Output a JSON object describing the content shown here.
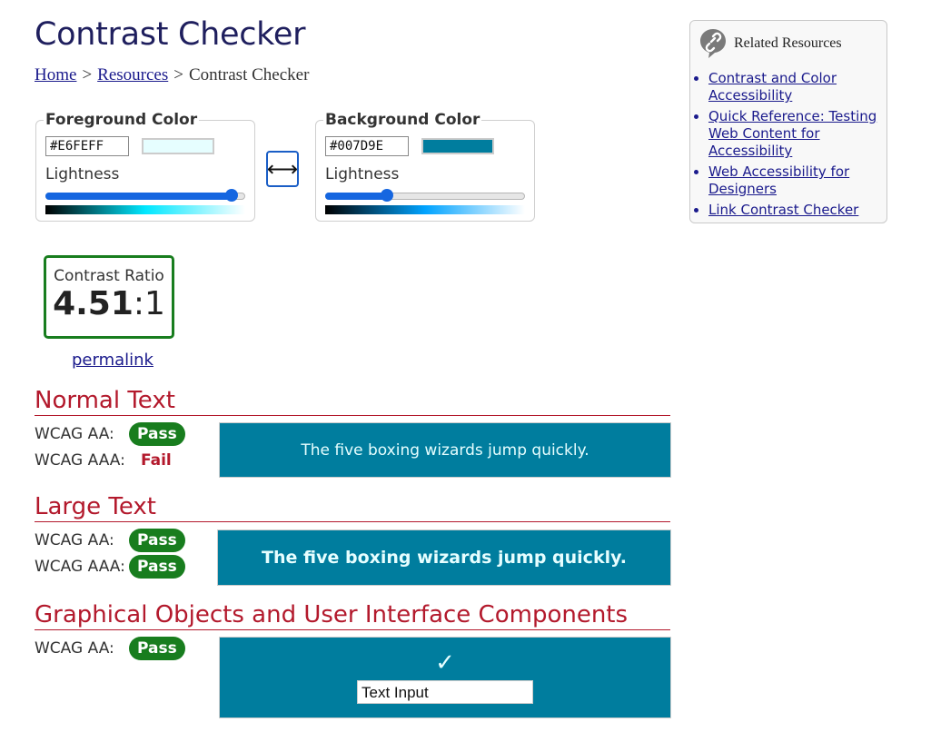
{
  "page": {
    "title": "Contrast Checker",
    "breadcrumb": {
      "home": "Home",
      "sep": ">",
      "resources": "Resources",
      "current": "Contrast Checker"
    }
  },
  "foreground": {
    "legend": "Foreground Color",
    "hex": "#E6FEFF",
    "swatch_color": "#E6FEFF",
    "lightness_label": "Lightness",
    "lightness_percent": 93,
    "gradient_colors": [
      "#000000",
      "#00e7ff",
      "#ffffff"
    ]
  },
  "background": {
    "legend": "Background Color",
    "hex": "#007D9E",
    "swatch_color": "#007D9E",
    "lightness_label": "Lightness",
    "lightness_percent": 31,
    "gradient_colors": [
      "#000000",
      "#00a3ff",
      "#ffffff"
    ]
  },
  "swap": {
    "icon": "swap-arrows-icon",
    "glyph": "⟷"
  },
  "ratio": {
    "label": "Contrast Ratio",
    "value": "4.51",
    "suffix": ":1",
    "border_color": "#187d1e"
  },
  "permalink": "permalink",
  "sections": {
    "normal": {
      "title": "Normal Text",
      "aa_label": "WCAG AA:",
      "aa_result": "Pass",
      "aaa_label": "WCAG AAA:",
      "aaa_result": "Fail",
      "sample": "The five boxing wizards jump quickly."
    },
    "large": {
      "title": "Large Text",
      "aa_label": "WCAG AA:",
      "aa_result": "Pass",
      "aaa_label": "WCAG AAA:",
      "aaa_result": "Pass",
      "sample": "The five boxing wizards jump quickly."
    },
    "ui": {
      "title": "Graphical Objects and User Interface Components",
      "aa_label": "WCAG AA:",
      "aa_result": "Pass",
      "check_glyph": "✓",
      "input_text": "Text Input"
    }
  },
  "related": {
    "title": "Related Resources",
    "icon": "link-icon",
    "links": [
      "Contrast and Color Accessibility",
      "Quick Reference: Testing Web Content for Accessibility",
      "Web Accessibility for Designers",
      "Link Contrast Checker"
    ]
  },
  "colors": {
    "pass": "#187d1e",
    "fail": "#b3192c",
    "heading": "#b3192c",
    "title": "#1f1f5e"
  }
}
